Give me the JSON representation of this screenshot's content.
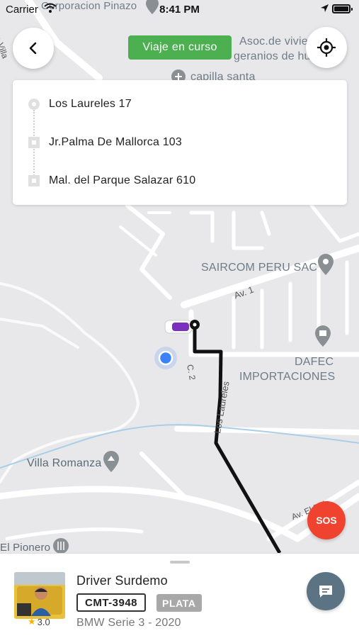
{
  "status_bar": {
    "carrier": "Carrier",
    "time": "8:41 PM"
  },
  "trip_status": "Viaje en curso",
  "route": {
    "origin": "Los Laureles 17",
    "stop": "Jr.Palma De Mallorca 103",
    "destination": "Mal. del Parque Salazar 610"
  },
  "map": {
    "labels": {
      "top_left_poi": "Corporacion Pinazo",
      "top_left_street": "Av. Villa",
      "assoc_line1": "Asoc.de vivie",
      "assoc_line2": "geranios de hu",
      "chapel": "capilla santa",
      "saircom": "SAIRCOM PERU SAC",
      "av1": "Av. 1",
      "dafec_line1": "DAFEC",
      "dafec_line2": "IMPORTACIONES",
      "c2": "C. 2",
      "los_laureles": "Los Laureles",
      "villa_romanza": "Villa Romanza",
      "av_el_polo": "Av. El Polo",
      "el_pionero": "El Pionero"
    },
    "route_color": "#111111",
    "user_location_color": "#3b82f6",
    "car_color": "#7b2fbf"
  },
  "sos_label": "SOS",
  "driver": {
    "name": "Driver Surdemo",
    "plate": "CMT-3948",
    "tier": "PLATA",
    "vehicle": "BMW Serie 3 - 2020",
    "rating": "3.0"
  },
  "colors": {
    "trip_status_bg": "#4caf50",
    "sos_bg": "#f0432f",
    "chat_bg": "#5b7383",
    "tier_bg": "#a8a8a8"
  },
  "icons": {
    "back": "chevron-left-icon",
    "locate": "crosshair-icon",
    "chat": "chat-bubble-icon",
    "star": "star-icon"
  }
}
